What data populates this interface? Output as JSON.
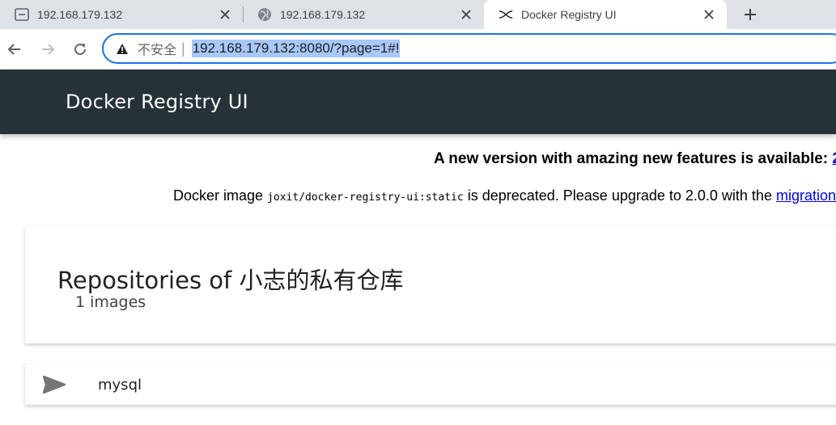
{
  "browser": {
    "tabs": [
      {
        "title": "192.168.179.132",
        "icon": "page-icon"
      },
      {
        "title": "192.168.179.132",
        "icon": "globe-icon"
      },
      {
        "title": "Docker Registry UI",
        "icon": "docker-registry-icon",
        "active": true
      }
    ],
    "address_bar": {
      "security_label": "不安全",
      "url": "192.168.179.132:8080/?page=1#!"
    },
    "accent_color": "#1a73e8"
  },
  "app": {
    "title": "Docker Registry UI",
    "header_color": "#263238"
  },
  "notices": {
    "new_version_text": "A new version with amazing new features is available: ",
    "new_version_link": "2",
    "deprecated_prefix": "Docker image ",
    "deprecated_image": "joxit/docker-registry-ui:static",
    "deprecated_middle": " is deprecated. Please upgrade to 2.0.0 with the ",
    "deprecated_link": "migration"
  },
  "repositories": {
    "title": "Repositories of 小志的私有仓库",
    "count_label": "1 images",
    "items": [
      {
        "name": "mysql",
        "icon": "send-icon"
      }
    ]
  }
}
